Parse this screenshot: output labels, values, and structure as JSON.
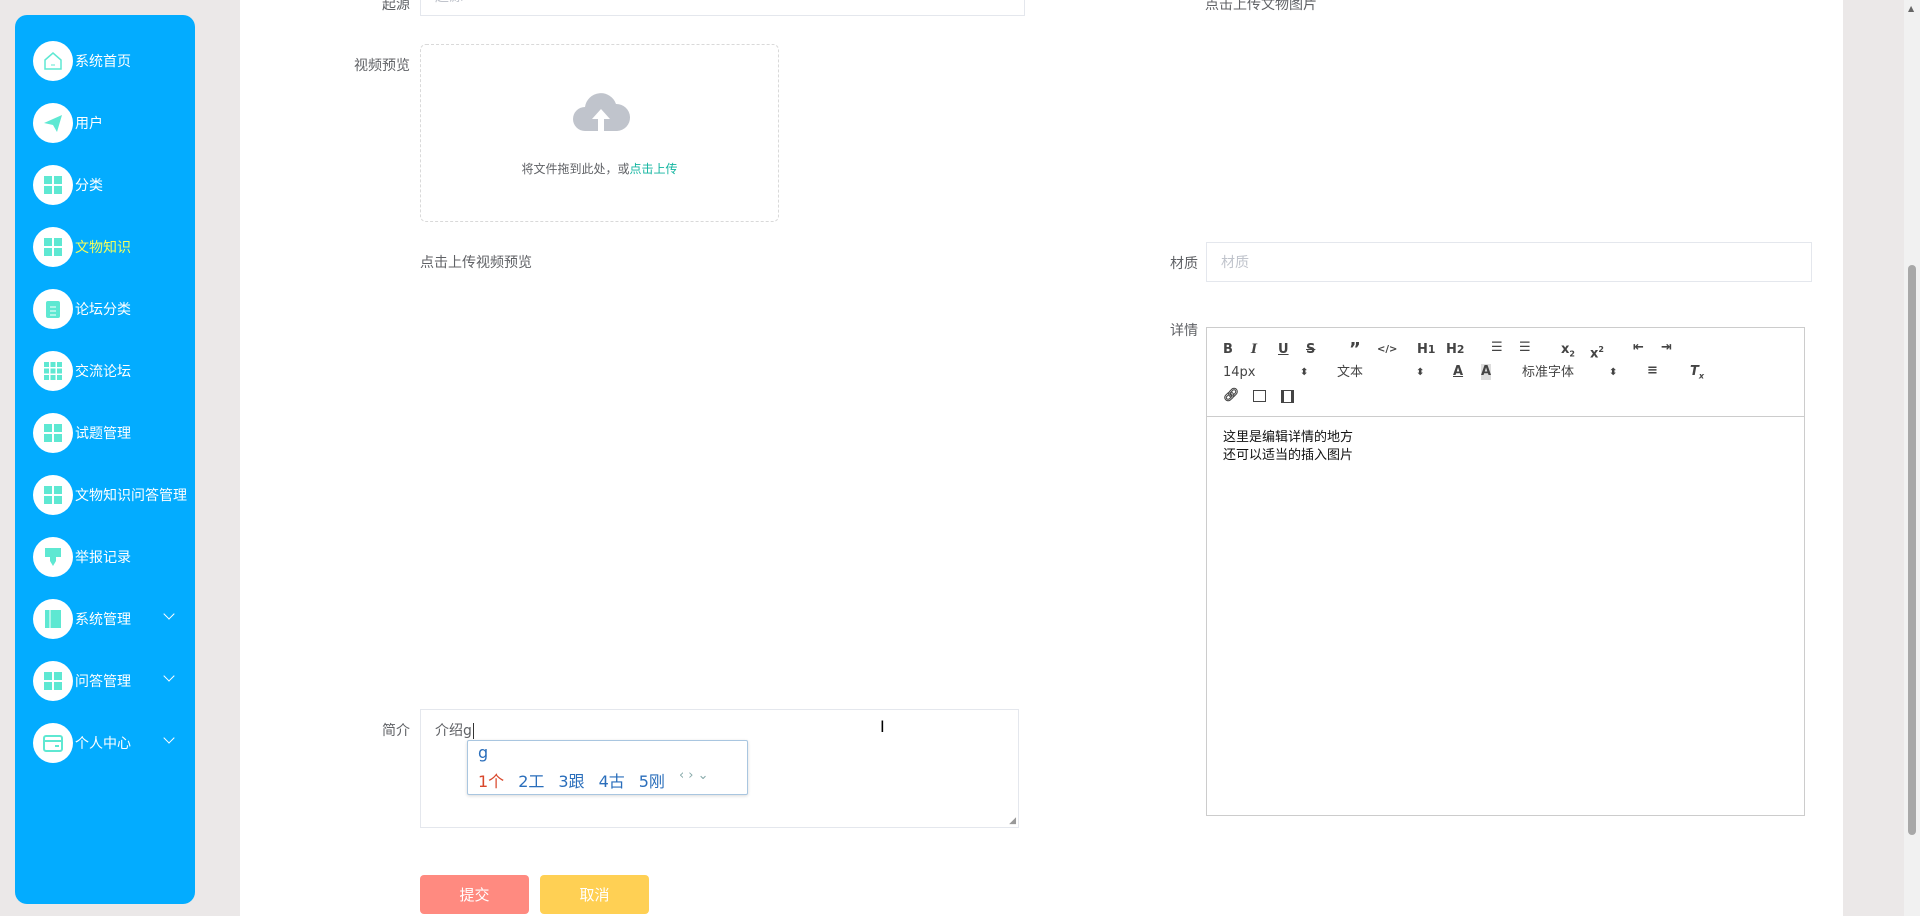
{
  "sidebar": {
    "items": [
      {
        "label": "系统首页",
        "icon": "home-icon"
      },
      {
        "label": "用户",
        "icon": "paper-plane-icon"
      },
      {
        "label": "分类",
        "icon": "grid-icon"
      },
      {
        "label": "文物知识",
        "icon": "grid-icon",
        "active": true
      },
      {
        "label": "论坛分类",
        "icon": "clipboard-icon"
      },
      {
        "label": "交流论坛",
        "icon": "grid-nine-icon"
      },
      {
        "label": "试题管理",
        "icon": "grid-icon"
      },
      {
        "label": "文物知识问答管理",
        "icon": "grid-icon"
      },
      {
        "label": "举报记录",
        "icon": "brush-icon"
      },
      {
        "label": "系统管理",
        "icon": "book-icon",
        "expandable": true
      },
      {
        "label": "问答管理",
        "icon": "grid-icon",
        "expandable": true
      },
      {
        "label": "个人中心",
        "icon": "wallet-icon",
        "expandable": true
      }
    ]
  },
  "colors": {
    "sidebar": "#03acff",
    "icon": "#5ee8d2",
    "active_text": "#f6ff5a",
    "submit": "#ff8a80",
    "cancel": "#ffd054",
    "link": "#13b5a0"
  },
  "form": {
    "origin": {
      "label": "起源",
      "placeholder": "起源"
    },
    "image_hint": "点击上传文物图片",
    "video": {
      "label": "视频预览",
      "drop_text": "将文件拖到此处，或",
      "click_text": "点击上传",
      "hint": "点击上传视频预览"
    },
    "material": {
      "label": "材质",
      "placeholder": "材质"
    },
    "detail": {
      "label": "详情",
      "font_size": "14px",
      "header": "文本",
      "font": "标准字体",
      "content_lines": [
        "这里是编辑详情的地方",
        "还可以适当的插入图片"
      ]
    },
    "intro": {
      "label": "简介",
      "value": "介绍g"
    },
    "ime": {
      "input": "g",
      "candidates": [
        "1个",
        "2工",
        "3跟",
        "4古",
        "5刚"
      ]
    },
    "submit": "提交",
    "cancel": "取消"
  }
}
